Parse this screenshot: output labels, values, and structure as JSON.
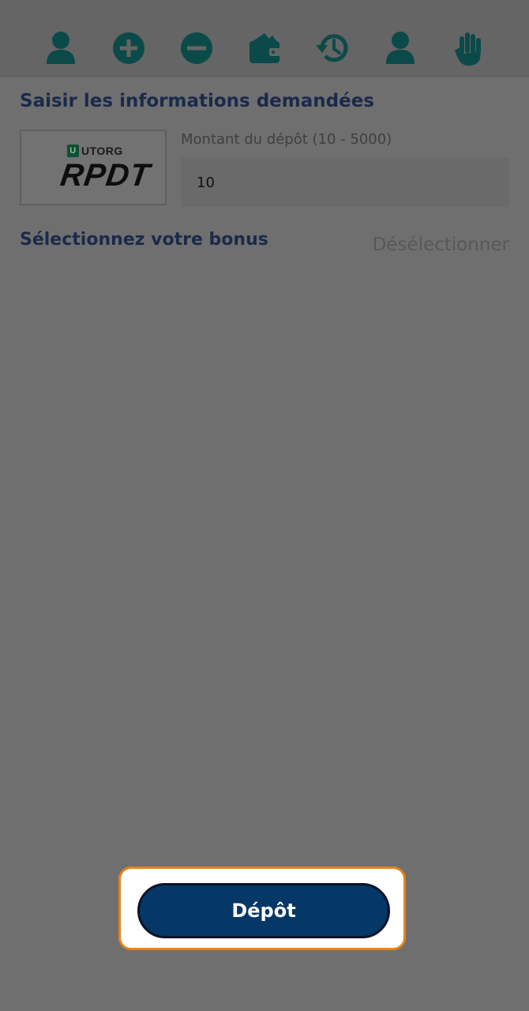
{
  "toolbar": {
    "icons": [
      {
        "name": "user-icon"
      },
      {
        "name": "plus-circle-icon"
      },
      {
        "name": "minus-circle-icon"
      },
      {
        "name": "wallet-icon"
      },
      {
        "name": "history-icon"
      },
      {
        "name": "profile-icon"
      },
      {
        "name": "hand-icon"
      }
    ],
    "icon_color": "#0b4a48",
    "background": "#656565"
  },
  "form": {
    "heading": "Saisir les informations demandées",
    "payment_method": {
      "brand": "UTORG",
      "badge": "U",
      "wordmark": "RPDT"
    },
    "amount": {
      "label": "Montant du dépôt (10 - 5000)",
      "value": "10"
    }
  },
  "bonus": {
    "title": "Sélectionnez votre bonus",
    "deselect_label": "Désélectionner"
  },
  "actions": {
    "deposit_label": "Dépôt",
    "deposit_color": "#053767",
    "highlight_color": "#e58318"
  }
}
